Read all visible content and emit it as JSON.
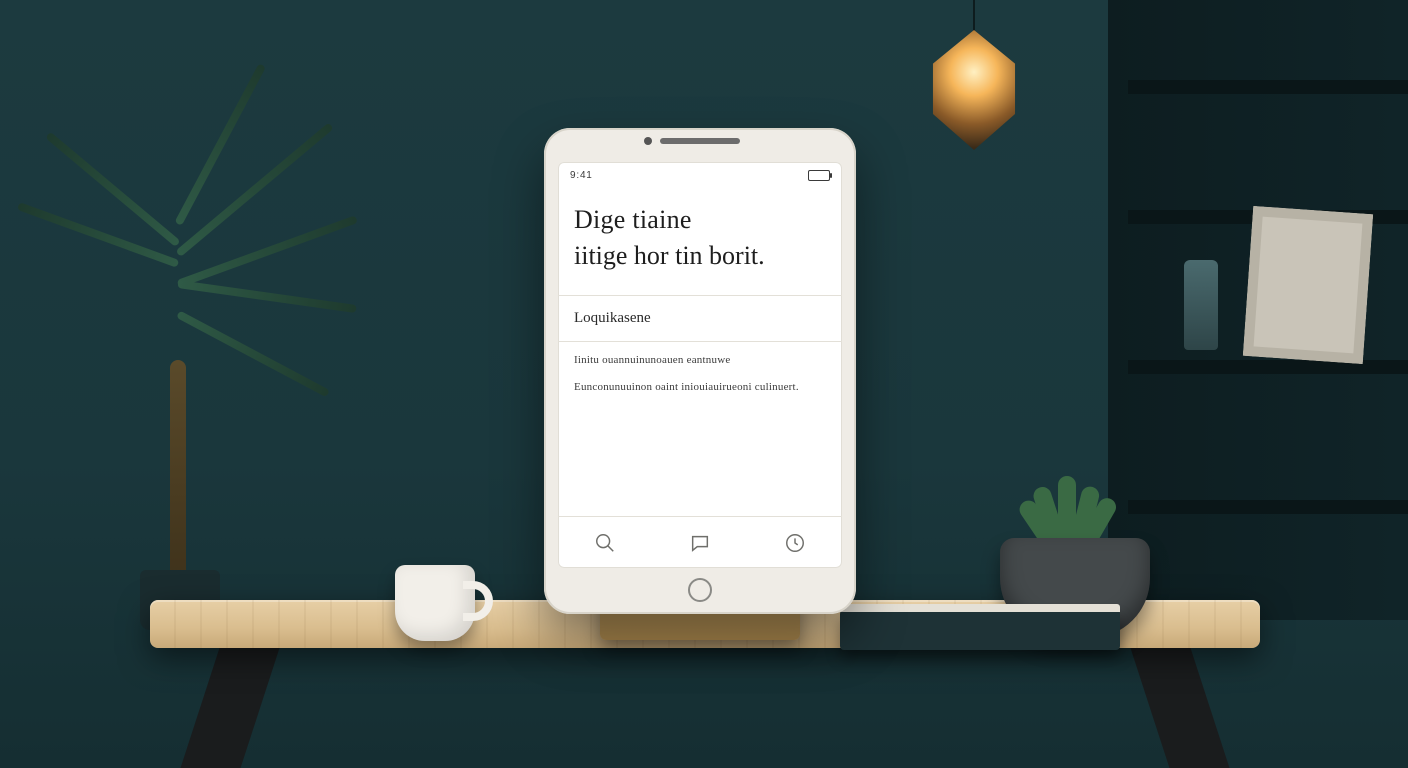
{
  "device": {
    "status_left": "9:41",
    "heading_line1": "Dige tiaine",
    "heading_line2": "iitige hor tin borit.",
    "section_label": "Loquikasene",
    "paragraph1": "Iinitu ouannuinunoauen eantnuwe",
    "paragraph2": "Eunconunuuinon oaint iniouiauirueoni culinuert.",
    "tabs": {
      "search": "search",
      "chat": "chat",
      "clock": "clock"
    }
  }
}
